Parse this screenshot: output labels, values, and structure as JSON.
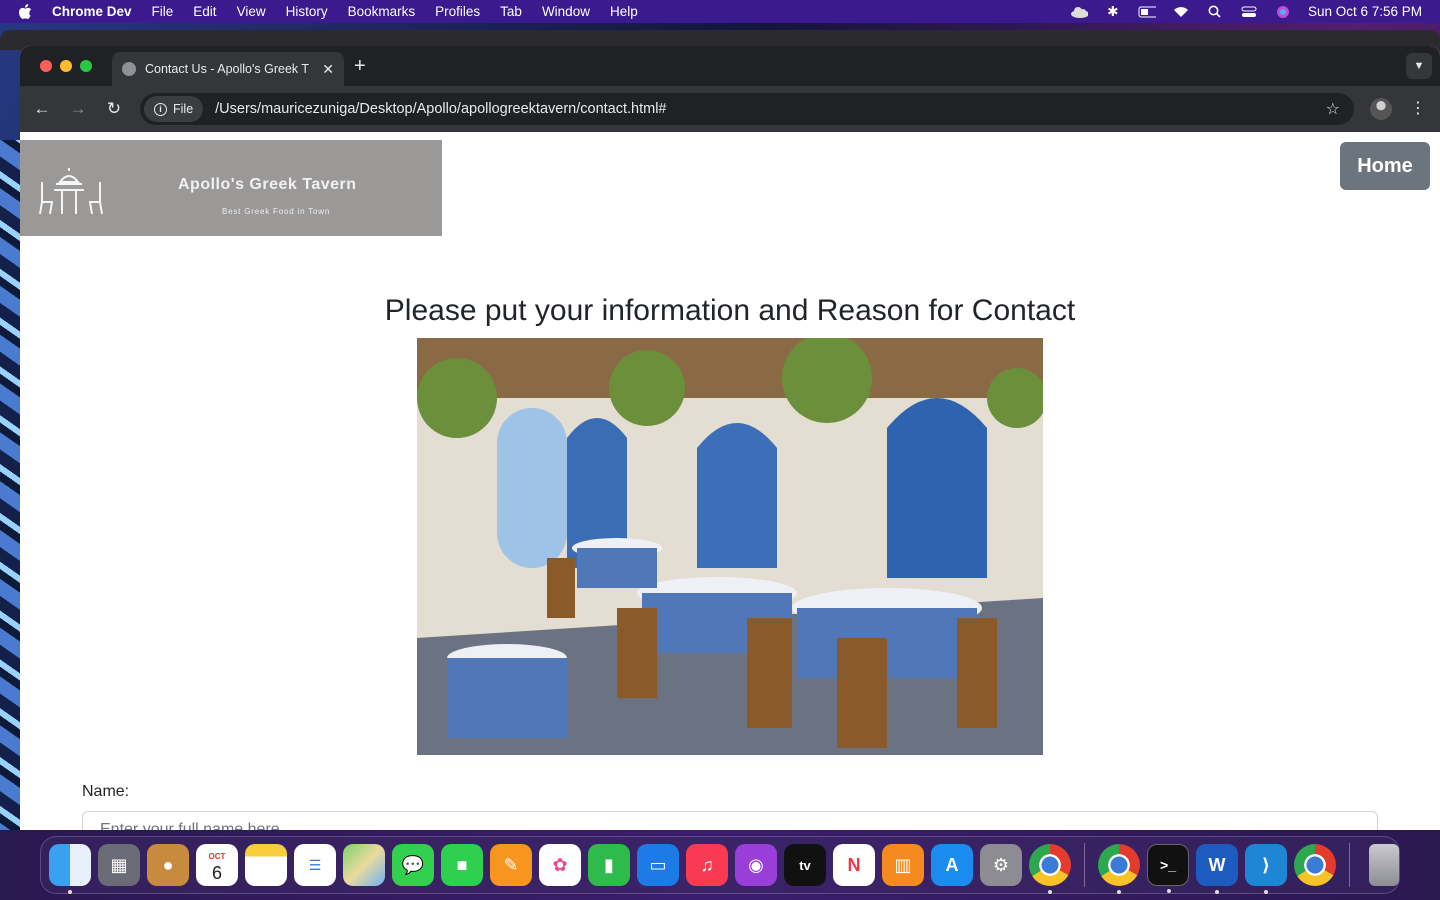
{
  "menubar": {
    "app_name": "Chrome Dev",
    "items": [
      "File",
      "Edit",
      "View",
      "History",
      "Bookmarks",
      "Profiles",
      "Tab",
      "Window",
      "Help"
    ],
    "clock": "Sun Oct 6  7:56 PM"
  },
  "browser": {
    "tab_title": "Contact Us - Apollo's Greek T",
    "url_chip": "File",
    "url": "/Users/mauricezuniga/Desktop/Apollo/apollogreektavern/contact.html#"
  },
  "page": {
    "logo_brand": "Apollo's Greek Tavern",
    "logo_tagline": "Best Greek Food in Town",
    "home_button": "Home",
    "heading": "Please put your information and Reason for Contact",
    "name_label": "Name:",
    "name_placeholder": "Enter your full name here"
  },
  "dock": {
    "calendar_month": "OCT",
    "calendar_day": "6",
    "apps": [
      "Finder",
      "Launchpad",
      "Contacts",
      "Calendar",
      "Notes",
      "Reminders",
      "Maps",
      "Messages",
      "FaceTime",
      "Pages",
      "Photos",
      "Numbers",
      "Keynote",
      "Music",
      "Podcasts",
      "TV",
      "News",
      "Books",
      "App Store",
      "System Settings",
      "Chrome",
      "Chrome Dev",
      "Terminal",
      "Word",
      "VS Code",
      "Chrome Canary",
      "Trash"
    ]
  }
}
